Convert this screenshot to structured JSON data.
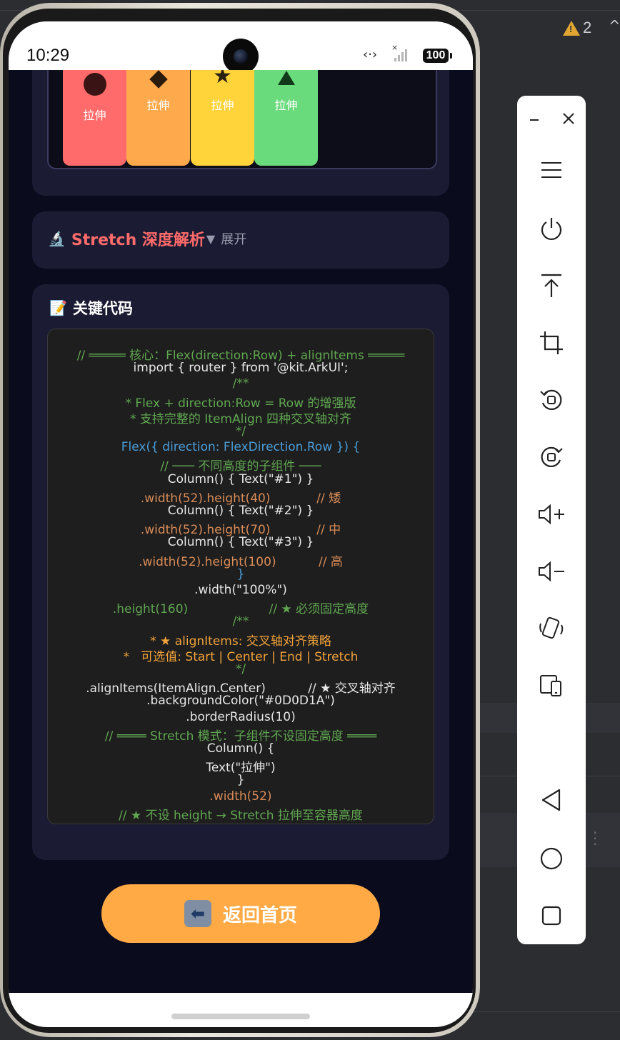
{
  "ide": {
    "warning_count": "2"
  },
  "status_bar": {
    "time": "10:29",
    "battery": "100"
  },
  "demo": {
    "items": [
      {
        "label": "拉伸",
        "color": "#ff6b6b",
        "shape": "circle"
      },
      {
        "label": "拉伸",
        "color": "#ffa94d",
        "shape": "diamond"
      },
      {
        "label": "拉伸",
        "color": "#ffd43b",
        "shape": "star"
      },
      {
        "label": "拉伸",
        "color": "#69db7c",
        "shape": "triangle"
      }
    ]
  },
  "analysis": {
    "icon": "🔬",
    "title": "Stretch 深度解析",
    "arrow": "▼",
    "toggle": "展开"
  },
  "code_section": {
    "icon": "📝",
    "title": "关键代码",
    "lines": [
      {
        "text": "// ═════ 核心：Flex(direction:Row) + alignItems ═════",
        "color": "green"
      },
      {
        "text": "import { router } from '@kit.ArkUI';",
        "color": "white"
      },
      {
        "text": "/**",
        "color": "green"
      },
      {
        "text": "* Flex + direction:Row = Row 的增强版",
        "color": "green"
      },
      {
        "text": "* 支持完整的 ItemAlign 四种交叉轴对齐",
        "color": "green"
      },
      {
        "text": "*/",
        "color": "green"
      },
      {
        "text": "Flex({ direction: FlexDirection.Row }) {",
        "color": "blue"
      },
      {
        "text": "// ─── 不同高度的子组件 ───",
        "color": "green"
      },
      {
        "text": "Column() { Text(\"#1\") }",
        "color": "white"
      },
      {
        "text": ".width(52).height(40)            // 矮",
        "color": "orange"
      },
      {
        "text": "Column() { Text(\"#2\") }",
        "color": "white"
      },
      {
        "text": ".width(52).height(70)            // 中",
        "color": "orange"
      },
      {
        "text": "Column() { Text(\"#3\") }",
        "color": "white"
      },
      {
        "text": ".width(52).height(100)           // 高",
        "color": "orange"
      },
      {
        "text": "}",
        "color": "blue"
      },
      {
        "text": ".width(\"100%\")",
        "color": "white"
      },
      {
        "text": ".height(160)                     // ★ 必须固定高度",
        "color": "green"
      },
      {
        "text": "/**",
        "color": "green"
      },
      {
        "text": "* ★ alignItems: 交叉轴对齐策略",
        "color": "yellow"
      },
      {
        "text": "*   可选值: Start | Center | End | Stretch",
        "color": "yellow"
      },
      {
        "text": "*/",
        "color": "green"
      },
      {
        "text": ".alignItems(ItemAlign.Center)           // ★ 交叉轴对齐",
        "color": "white"
      },
      {
        "text": ".backgroundColor(\"#0D0D1A\")",
        "color": "white"
      },
      {
        "text": ".borderRadius(10)",
        "color": "white"
      },
      {
        "text": "// ════ Stretch 模式：子组件不设固定高度 ════",
        "color": "green"
      },
      {
        "text": "Column() {",
        "color": "white"
      },
      {
        "text": "Text(\"拉伸\")",
        "color": "white"
      },
      {
        "text": "}",
        "color": "white"
      },
      {
        "text": ".width(52)",
        "color": "orange"
      },
      {
        "text": "// ★ 不设 height → Stretch 拉伸至容器高度",
        "color": "green"
      }
    ]
  },
  "back_button": {
    "icon": "⬅️",
    "label": "返回首页"
  },
  "side_panel": {
    "items": [
      "minimize",
      "close",
      "menu",
      "power",
      "pin-top",
      "crop",
      "rotate-left",
      "rotate-right",
      "volume-up",
      "volume-down",
      "shake",
      "fold",
      "back",
      "home",
      "recents"
    ]
  }
}
